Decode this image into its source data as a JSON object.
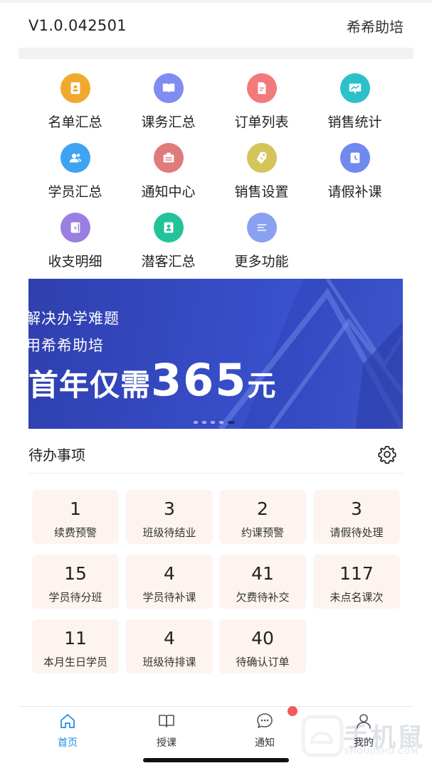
{
  "header": {
    "version": "V1.0.042501",
    "brand": "希希助培"
  },
  "menu": [
    {
      "label": "名单汇总",
      "icon": "contacts-book-icon",
      "color": "#f0a92c"
    },
    {
      "label": "课务汇总",
      "icon": "open-book-icon",
      "color": "#7f8cf2"
    },
    {
      "label": "订单列表",
      "icon": "document-icon",
      "color": "#f27a7a"
    },
    {
      "label": "销售统计",
      "icon": "chart-board-icon",
      "color": "#2cc1c9"
    },
    {
      "label": "学员汇总",
      "icon": "users-icon",
      "color": "#3ea3f0"
    },
    {
      "label": "通知中心",
      "icon": "notice-icon",
      "color": "#e07b7b"
    },
    {
      "label": "销售设置",
      "icon": "price-tag-icon",
      "color": "#d3c55a"
    },
    {
      "label": "请假补课",
      "icon": "calendar-clock-icon",
      "color": "#6f89ee"
    },
    {
      "label": "收支明细",
      "icon": "finance-book-icon",
      "color": "#9a7ee0"
    },
    {
      "label": "潜客汇总",
      "icon": "contact-card-icon",
      "color": "#23c39a"
    },
    {
      "label": "更多功能",
      "icon": "more-lines-icon",
      "color": "#8aa0f0"
    }
  ],
  "banner": {
    "line1": "解决办学难题",
    "line2": "用希希助培",
    "line3_pre": "首年仅需",
    "line3_num": "365",
    "line3_post": "元",
    "dots_total": 5,
    "dots_active_index": 4
  },
  "todo": {
    "title": "待办事项",
    "settings_icon": "gear-icon",
    "cards": [
      {
        "count": "1",
        "label": "续费预警"
      },
      {
        "count": "3",
        "label": "班级待结业"
      },
      {
        "count": "2",
        "label": "约课预警"
      },
      {
        "count": "3",
        "label": "请假待处理"
      },
      {
        "count": "15",
        "label": "学员待分班"
      },
      {
        "count": "4",
        "label": "学员待补课"
      },
      {
        "count": "41",
        "label": "欠费待补交"
      },
      {
        "count": "117",
        "label": "未点名课次"
      },
      {
        "count": "11",
        "label": "本月生日学员"
      },
      {
        "count": "4",
        "label": "班级待排课"
      },
      {
        "count": "40",
        "label": "待确认订单"
      }
    ]
  },
  "tabbar": {
    "tabs": [
      {
        "label": "首页",
        "icon": "home-icon",
        "active": true
      },
      {
        "label": "授课",
        "icon": "book-icon",
        "active": false
      },
      {
        "label": "通知",
        "icon": "chat-bubble-icon",
        "active": false,
        "badge": true
      },
      {
        "label": "我的",
        "icon": "user-icon",
        "active": false
      }
    ],
    "active_color": "#1e8ee8"
  },
  "watermark": {
    "text": "手机鼠",
    "url": "SHOUJISHU.COM"
  }
}
